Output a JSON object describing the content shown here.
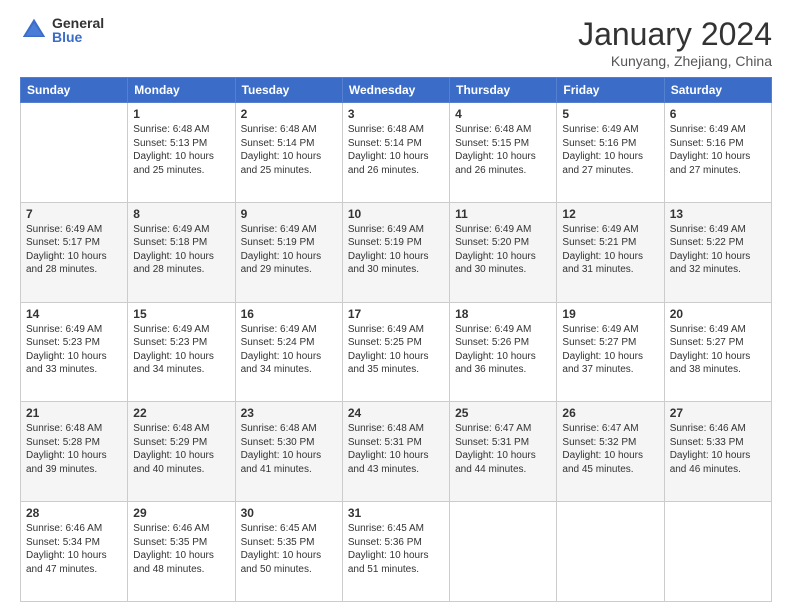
{
  "header": {
    "logo_general": "General",
    "logo_blue": "Blue",
    "month_title": "January 2024",
    "location": "Kunyang, Zhejiang, China"
  },
  "calendar": {
    "days_of_week": [
      "Sunday",
      "Monday",
      "Tuesday",
      "Wednesday",
      "Thursday",
      "Friday",
      "Saturday"
    ],
    "weeks": [
      [
        {
          "day": "",
          "info": ""
        },
        {
          "day": "1",
          "info": "Sunrise: 6:48 AM\nSunset: 5:13 PM\nDaylight: 10 hours\nand 25 minutes."
        },
        {
          "day": "2",
          "info": "Sunrise: 6:48 AM\nSunset: 5:14 PM\nDaylight: 10 hours\nand 25 minutes."
        },
        {
          "day": "3",
          "info": "Sunrise: 6:48 AM\nSunset: 5:14 PM\nDaylight: 10 hours\nand 26 minutes."
        },
        {
          "day": "4",
          "info": "Sunrise: 6:48 AM\nSunset: 5:15 PM\nDaylight: 10 hours\nand 26 minutes."
        },
        {
          "day": "5",
          "info": "Sunrise: 6:49 AM\nSunset: 5:16 PM\nDaylight: 10 hours\nand 27 minutes."
        },
        {
          "day": "6",
          "info": "Sunrise: 6:49 AM\nSunset: 5:16 PM\nDaylight: 10 hours\nand 27 minutes."
        }
      ],
      [
        {
          "day": "7",
          "info": "Sunrise: 6:49 AM\nSunset: 5:17 PM\nDaylight: 10 hours\nand 28 minutes."
        },
        {
          "day": "8",
          "info": "Sunrise: 6:49 AM\nSunset: 5:18 PM\nDaylight: 10 hours\nand 28 minutes."
        },
        {
          "day": "9",
          "info": "Sunrise: 6:49 AM\nSunset: 5:19 PM\nDaylight: 10 hours\nand 29 minutes."
        },
        {
          "day": "10",
          "info": "Sunrise: 6:49 AM\nSunset: 5:19 PM\nDaylight: 10 hours\nand 30 minutes."
        },
        {
          "day": "11",
          "info": "Sunrise: 6:49 AM\nSunset: 5:20 PM\nDaylight: 10 hours\nand 30 minutes."
        },
        {
          "day": "12",
          "info": "Sunrise: 6:49 AM\nSunset: 5:21 PM\nDaylight: 10 hours\nand 31 minutes."
        },
        {
          "day": "13",
          "info": "Sunrise: 6:49 AM\nSunset: 5:22 PM\nDaylight: 10 hours\nand 32 minutes."
        }
      ],
      [
        {
          "day": "14",
          "info": "Sunrise: 6:49 AM\nSunset: 5:23 PM\nDaylight: 10 hours\nand 33 minutes."
        },
        {
          "day": "15",
          "info": "Sunrise: 6:49 AM\nSunset: 5:23 PM\nDaylight: 10 hours\nand 34 minutes."
        },
        {
          "day": "16",
          "info": "Sunrise: 6:49 AM\nSunset: 5:24 PM\nDaylight: 10 hours\nand 34 minutes."
        },
        {
          "day": "17",
          "info": "Sunrise: 6:49 AM\nSunset: 5:25 PM\nDaylight: 10 hours\nand 35 minutes."
        },
        {
          "day": "18",
          "info": "Sunrise: 6:49 AM\nSunset: 5:26 PM\nDaylight: 10 hours\nand 36 minutes."
        },
        {
          "day": "19",
          "info": "Sunrise: 6:49 AM\nSunset: 5:27 PM\nDaylight: 10 hours\nand 37 minutes."
        },
        {
          "day": "20",
          "info": "Sunrise: 6:49 AM\nSunset: 5:27 PM\nDaylight: 10 hours\nand 38 minutes."
        }
      ],
      [
        {
          "day": "21",
          "info": "Sunrise: 6:48 AM\nSunset: 5:28 PM\nDaylight: 10 hours\nand 39 minutes."
        },
        {
          "day": "22",
          "info": "Sunrise: 6:48 AM\nSunset: 5:29 PM\nDaylight: 10 hours\nand 40 minutes."
        },
        {
          "day": "23",
          "info": "Sunrise: 6:48 AM\nSunset: 5:30 PM\nDaylight: 10 hours\nand 41 minutes."
        },
        {
          "day": "24",
          "info": "Sunrise: 6:48 AM\nSunset: 5:31 PM\nDaylight: 10 hours\nand 43 minutes."
        },
        {
          "day": "25",
          "info": "Sunrise: 6:47 AM\nSunset: 5:31 PM\nDaylight: 10 hours\nand 44 minutes."
        },
        {
          "day": "26",
          "info": "Sunrise: 6:47 AM\nSunset: 5:32 PM\nDaylight: 10 hours\nand 45 minutes."
        },
        {
          "day": "27",
          "info": "Sunrise: 6:46 AM\nSunset: 5:33 PM\nDaylight: 10 hours\nand 46 minutes."
        }
      ],
      [
        {
          "day": "28",
          "info": "Sunrise: 6:46 AM\nSunset: 5:34 PM\nDaylight: 10 hours\nand 47 minutes."
        },
        {
          "day": "29",
          "info": "Sunrise: 6:46 AM\nSunset: 5:35 PM\nDaylight: 10 hours\nand 48 minutes."
        },
        {
          "day": "30",
          "info": "Sunrise: 6:45 AM\nSunset: 5:35 PM\nDaylight: 10 hours\nand 50 minutes."
        },
        {
          "day": "31",
          "info": "Sunrise: 6:45 AM\nSunset: 5:36 PM\nDaylight: 10 hours\nand 51 minutes."
        },
        {
          "day": "",
          "info": ""
        },
        {
          "day": "",
          "info": ""
        },
        {
          "day": "",
          "info": ""
        }
      ]
    ]
  }
}
